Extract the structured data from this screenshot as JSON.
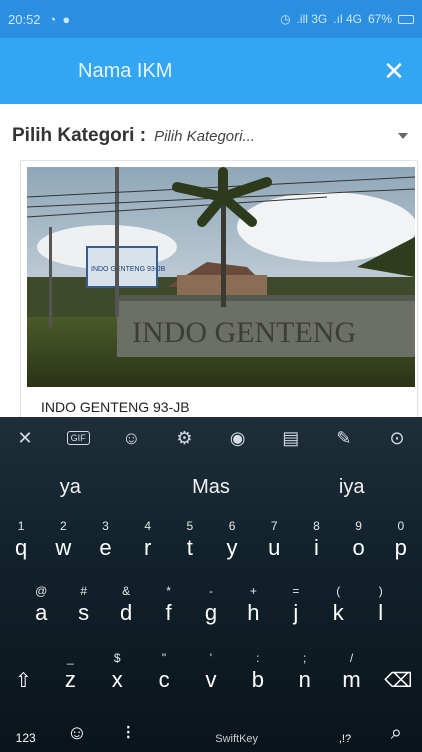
{
  "status_bar": {
    "time": "20:52",
    "signal": ".ill 3G",
    "signal2": ".ıl 4G",
    "battery": "67%"
  },
  "app_bar": {
    "title": "Nama IKM",
    "close_glyph": "✕"
  },
  "filter": {
    "label": "Pilih Kategori :",
    "selected": "Pilih Kategori..."
  },
  "card": {
    "title": "INDO GENTENG 93-JB",
    "sign_text": "INDO GENTENG 93-JB",
    "wall_text": "INDO GENTENG"
  },
  "keyboard": {
    "toolbar": [
      "close-icon",
      "gif-icon",
      "sticker-icon",
      "settings-icon",
      "theme-icon",
      "clipboard-icon",
      "pin-icon",
      "location-icon"
    ],
    "suggestions": [
      "ya",
      "Mas",
      "iya"
    ],
    "row1": [
      {
        "k": "q",
        "h": "1"
      },
      {
        "k": "w",
        "h": "2"
      },
      {
        "k": "e",
        "h": "3"
      },
      {
        "k": "r",
        "h": "4"
      },
      {
        "k": "t",
        "h": "5"
      },
      {
        "k": "y",
        "h": "6"
      },
      {
        "k": "u",
        "h": "7"
      },
      {
        "k": "i",
        "h": "8"
      },
      {
        "k": "o",
        "h": "9"
      },
      {
        "k": "p",
        "h": "0"
      }
    ],
    "row2": [
      {
        "k": "a",
        "h": "@"
      },
      {
        "k": "s",
        "h": "#"
      },
      {
        "k": "d",
        "h": "&"
      },
      {
        "k": "f",
        "h": "*"
      },
      {
        "k": "g",
        "h": "-"
      },
      {
        "k": "h",
        "h": "+"
      },
      {
        "k": "j",
        "h": "="
      },
      {
        "k": "k",
        "h": "("
      },
      {
        "k": "l",
        "h": ")"
      }
    ],
    "row3": [
      {
        "k": "z",
        "h": "_"
      },
      {
        "k": "x",
        "h": "$"
      },
      {
        "k": "c",
        "h": "\""
      },
      {
        "k": "v",
        "h": "'"
      },
      {
        "k": "b",
        "h": ":"
      },
      {
        "k": "n",
        "h": ";"
      },
      {
        "k": "m",
        "h": "/"
      }
    ],
    "numbers_key": "123",
    "space_label": "SwiftKey",
    "punct_hint": ",!?"
  }
}
